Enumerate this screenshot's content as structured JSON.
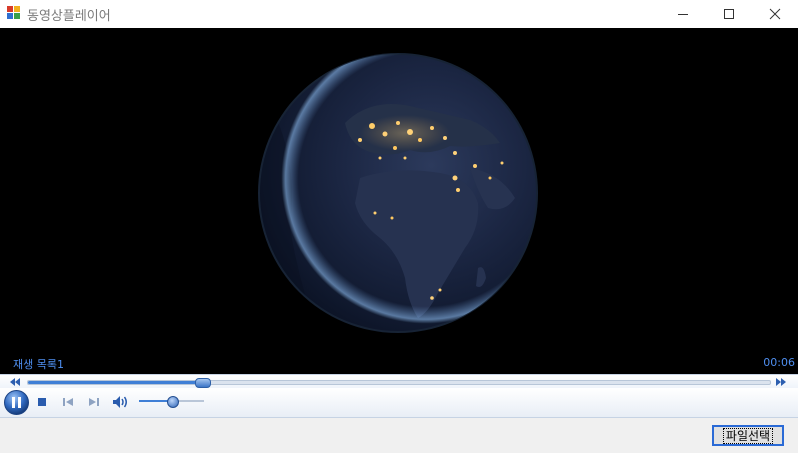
{
  "window": {
    "title": "동영상플레이어"
  },
  "player": {
    "playlist_label": "재생 목록1",
    "time": "00:06",
    "seek_progress": 0.235,
    "volume_level": 0.5,
    "state": "playing"
  },
  "actions": {
    "file_select_label": "파일선택"
  },
  "colors": {
    "accent": "#3f7fd6",
    "overlay_text": "#4f8ff0",
    "video_background": "#000000"
  },
  "icons": {
    "app": "app-icon",
    "minimize": "minimize-icon",
    "maximize": "maximize-icon",
    "close": "close-icon",
    "rewind": "rewind-icon",
    "fast_forward": "fast-forward-icon",
    "pause": "pause-icon",
    "stop": "stop-icon",
    "previous": "previous-icon",
    "next": "next-icon",
    "volume": "volume-icon"
  }
}
